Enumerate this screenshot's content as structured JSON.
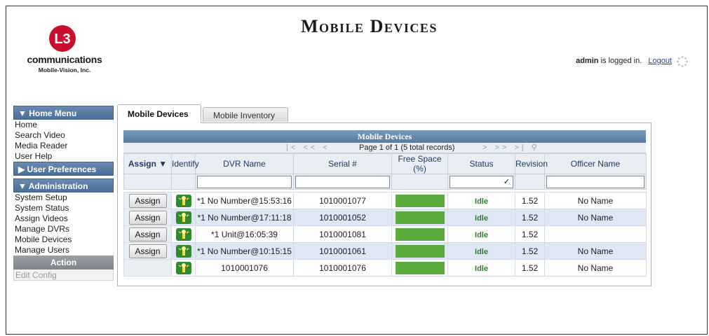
{
  "header": {
    "title": "Mobile Devices",
    "logo_mark": "L3",
    "logo_text": "communications",
    "logo_sub": "Mobile-Vision, Inc.",
    "user": "admin",
    "login_suffix": "is logged in.",
    "logout_label": "Logout"
  },
  "sidebar": {
    "home_menu": {
      "label": "▼ Home Menu",
      "items": [
        "Home",
        "Search Video",
        "Media Reader",
        "User Help"
      ]
    },
    "user_prefs": {
      "label": "▶ User Preferences"
    },
    "administration": {
      "label": "▼ Administration",
      "items": [
        "System Setup",
        "System Status",
        "Assign Videos",
        "Manage DVRs",
        "Mobile Devices",
        "Manage Users"
      ]
    },
    "action": {
      "label": "Action",
      "items": [
        "Edit Config"
      ]
    }
  },
  "tabs": [
    {
      "label": "Mobile Devices",
      "active": true
    },
    {
      "label": "Mobile Inventory",
      "active": false
    }
  ],
  "grid": {
    "title": "Mobile Devices",
    "pager_text": "Page 1 of 1 (5 total records)",
    "columns": [
      "Assign ▼",
      "Identify",
      "DVR Name",
      "Serial #",
      "Free Space (%)",
      "Status",
      "Revision",
      "Officer Name"
    ],
    "rows": [
      {
        "assign": "Assign",
        "dvr_name": "*1 No Number@15:53:16",
        "serial": "1010001077",
        "free_space": 100,
        "status": "Idle",
        "revision": "1.52",
        "officer": "No Name"
      },
      {
        "assign": "Assign",
        "dvr_name": "*1 No Number@17:11:18",
        "serial": "1010001052",
        "free_space": 100,
        "status": "Idle",
        "revision": "1.52",
        "officer": "No Name"
      },
      {
        "assign": "Assign",
        "dvr_name": "*1 Unit@16:05:39",
        "serial": "1010001081",
        "free_space": 100,
        "status": "Idle",
        "revision": "1.52",
        "officer": ""
      },
      {
        "assign": "Assign",
        "dvr_name": "*1 No Number@10:15:15",
        "serial": "1010001061",
        "free_space": 100,
        "status": "Idle",
        "revision": "1.52",
        "officer": "No Name"
      },
      {
        "assign": "",
        "dvr_name": "1010001076",
        "serial": "1010001076",
        "free_space": 100,
        "status": "Idle",
        "revision": "1.52",
        "officer": "No Name"
      }
    ]
  },
  "colors": {
    "header_blue": "#5a7ca3",
    "status_green": "#2f7a2f",
    "bar_green": "#5aaa3c",
    "alt_row": "#dfe7f7"
  }
}
